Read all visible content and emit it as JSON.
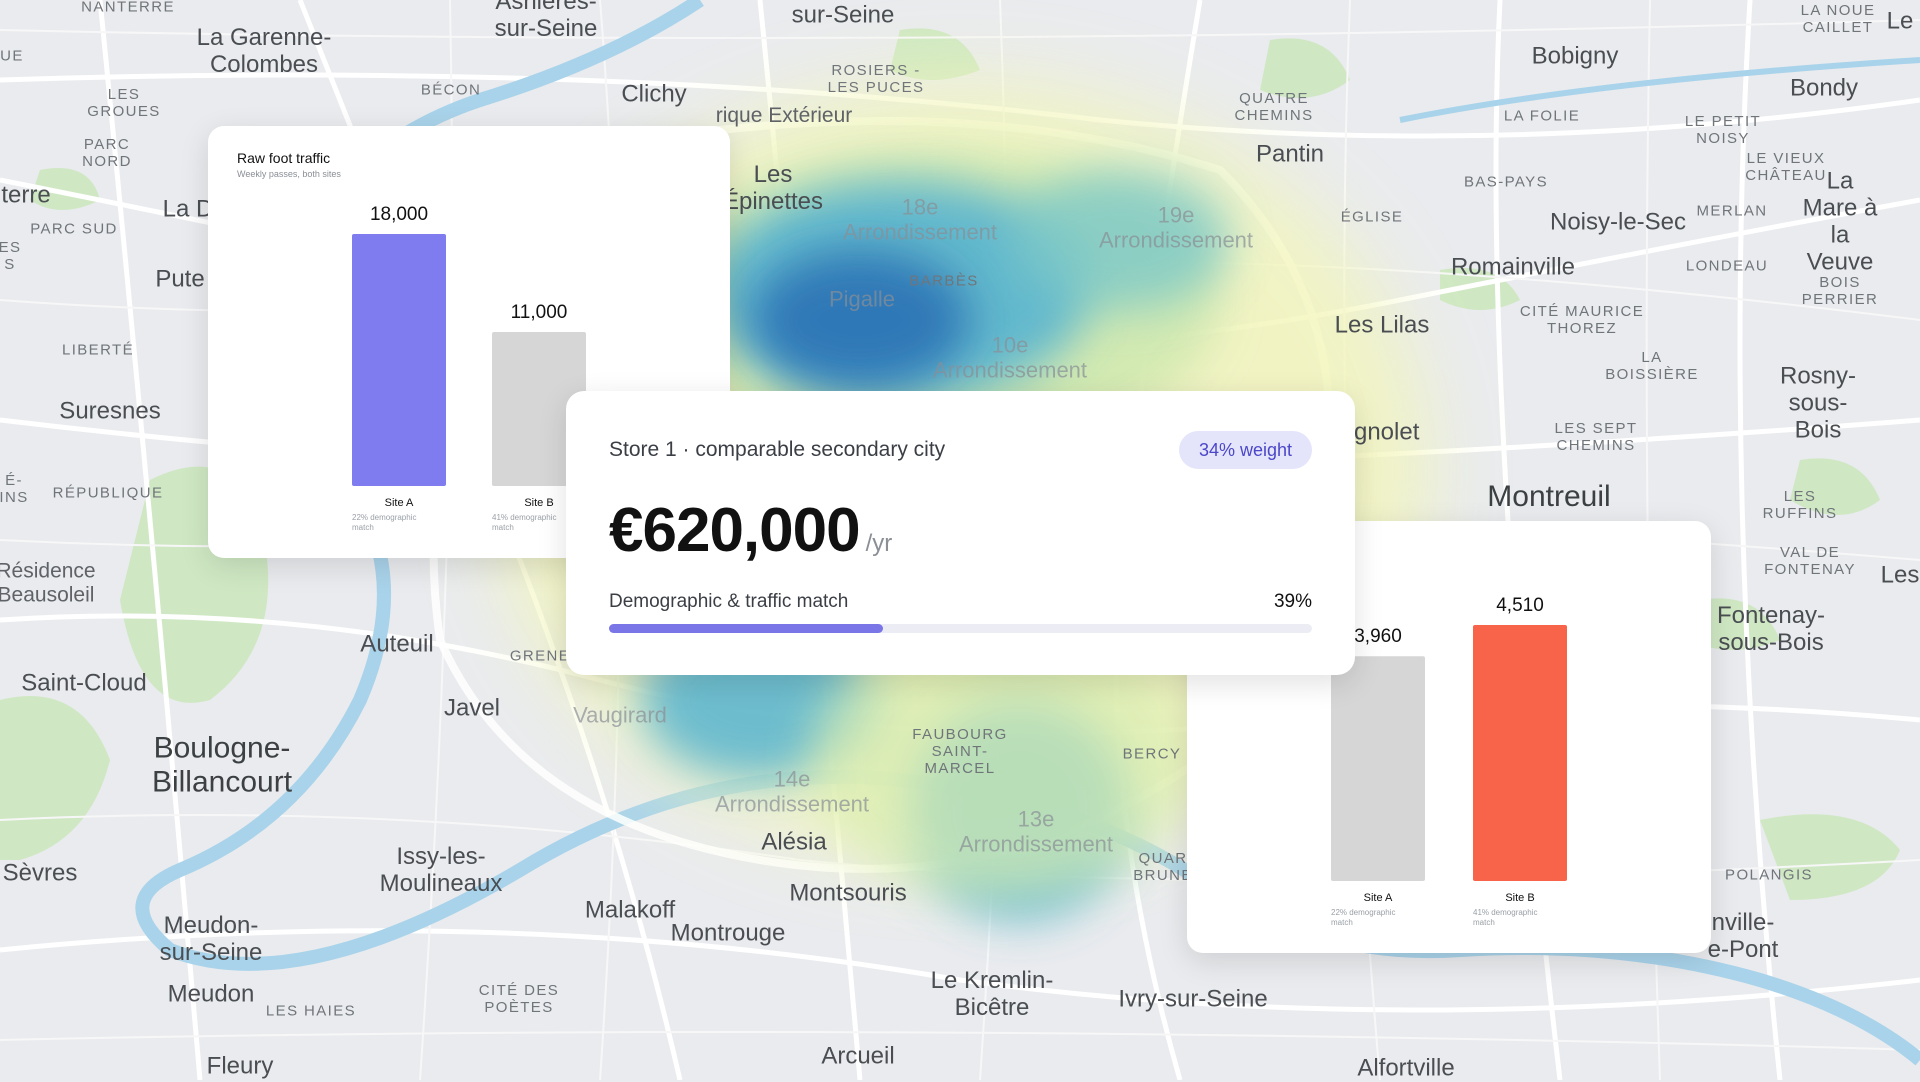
{
  "map": {
    "places": [
      {
        "name": "Nanterre",
        "text": "NANTERRE",
        "style": "dist"
      },
      {
        "name": "La Garenne-Colombes",
        "text": "La Garenne-\nColombes",
        "style": "mid"
      },
      {
        "name": "Asnieres-sur-Seine",
        "text": "Asnières-\nsur-Seine",
        "style": "mid"
      },
      {
        "name": "Clichy",
        "text": "Clichy",
        "style": "mid"
      },
      {
        "name": "Becon",
        "text": "BÉCON",
        "style": "dist"
      },
      {
        "name": "Les Groues",
        "text": "LES\nGROUES",
        "style": "dist"
      },
      {
        "name": "Parc Nord",
        "text": "PARC\nNORD",
        "style": "dist"
      },
      {
        "name": "Parc Sud",
        "text": "PARC SUD",
        "style": "dist"
      },
      {
        "name": "Liberte",
        "text": "LIBERTÉ",
        "style": "dist"
      },
      {
        "name": "Suresnes",
        "text": "Suresnes",
        "style": "mid"
      },
      {
        "name": "Republique",
        "text": "RÉPUBLIQUE",
        "style": "dist"
      },
      {
        "name": "Residence Beausoleil",
        "text": "Résidence\nBeausoleil",
        "style": ""
      },
      {
        "name": "Saint-Cloud",
        "text": "Saint-Cloud",
        "style": "mid"
      },
      {
        "name": "Boulogne-Billancourt",
        "text": "Boulogne-\nBillancourt",
        "style": "big"
      },
      {
        "name": "Auteuil",
        "text": "Auteuil",
        "style": "mid"
      },
      {
        "name": "Javel",
        "text": "Javel",
        "style": "mid"
      },
      {
        "name": "Sevres",
        "text": "Sèvres",
        "style": "mid"
      },
      {
        "name": "Issy-les-Moulineaux",
        "text": "Issy-les-\nMoulineaux",
        "style": "mid"
      },
      {
        "name": "Meudon-sur-Seine",
        "text": "Meudon-\nsur-Seine",
        "style": "mid"
      },
      {
        "name": "Meudon",
        "text": "Meudon",
        "style": "mid"
      },
      {
        "name": "Les Haies",
        "text": "LES HAIES",
        "style": "dist"
      },
      {
        "name": "Fleury",
        "text": "Fleury",
        "style": "mid"
      },
      {
        "name": "Malakoff",
        "text": "Malakoff",
        "style": "mid"
      },
      {
        "name": "Montrouge",
        "text": "Montrouge",
        "style": "mid"
      },
      {
        "name": "Cite des Poetes",
        "text": "CITÉ DES\nPOÈTES",
        "style": "dist"
      },
      {
        "name": "Montsouris",
        "text": "Montsouris",
        "style": "mid"
      },
      {
        "name": "Alesia",
        "text": "Alésia",
        "style": "mid"
      },
      {
        "name": "Le Kremlin-Bicetre",
        "text": "Le Kremlin-\nBicêtre",
        "style": "mid"
      },
      {
        "name": "Arcueil",
        "text": "Arcueil",
        "style": "mid"
      },
      {
        "name": "Ivry-sur-Seine",
        "text": "Ivry-sur-Seine",
        "style": "mid"
      },
      {
        "name": "Alfortville",
        "text": "Alfortville",
        "style": "mid"
      },
      {
        "name": "Rosiers les Puces",
        "text": "ROSIERS -\nLES PUCES",
        "style": "dist"
      },
      {
        "name": "Saint-Denis",
        "text": "sur-Seine",
        "style": "mid"
      },
      {
        "name": "Les Epinettes",
        "text": "Les\nÉpinettes",
        "style": "mid"
      },
      {
        "name": "Pantin",
        "text": "Pantin",
        "style": "mid"
      },
      {
        "name": "Quatre Chemins",
        "text": "QUATRE\nCHEMINS",
        "style": "dist"
      },
      {
        "name": "Bobigny",
        "text": "Bobigny",
        "style": "mid"
      },
      {
        "name": "La Folie",
        "text": "LA FOLIE",
        "style": "dist"
      },
      {
        "name": "Bondy",
        "text": "Bondy",
        "style": "mid"
      },
      {
        "name": "La Noue Caillet",
        "text": "LA NOUE\nCAILLET",
        "style": "dist"
      },
      {
        "name": "Le Petit Noisy",
        "text": "LE PETIT\nNOISY",
        "style": "dist"
      },
      {
        "name": "Le Vieux Chateau",
        "text": "LE VIEUX\nCHÂTEAU",
        "style": "dist"
      },
      {
        "name": "Bas-Pays",
        "text": "BAS-PAYS",
        "style": "dist"
      },
      {
        "name": "Eglise",
        "text": "ÉGLISE",
        "style": "dist"
      },
      {
        "name": "Noisy-le-Sec",
        "text": "Noisy-le-Sec",
        "style": "mid"
      },
      {
        "name": "Merlan",
        "text": "MERLAN",
        "style": "dist"
      },
      {
        "name": "La Mare a la Veuve",
        "text": "La Mare à\nla Veuve",
        "style": "mid"
      },
      {
        "name": "Romainville",
        "text": "Romainville",
        "style": "mid"
      },
      {
        "name": "Londeau",
        "text": "LONDEAU",
        "style": "dist"
      },
      {
        "name": "Bois Perrier",
        "text": "BOIS\nPERRIER",
        "style": "dist"
      },
      {
        "name": "Les Lilas",
        "text": "Les Lilas",
        "style": "mid"
      },
      {
        "name": "Cite Maurice Thorez",
        "text": "CITÉ MAURICE\nTHOREZ",
        "style": "dist"
      },
      {
        "name": "La Boissiere",
        "text": "LA\nBOISSIÈRE",
        "style": "dist"
      },
      {
        "name": "Rosny-sous-Bois",
        "text": "Rosny-\nsous-Bois",
        "style": "mid"
      },
      {
        "name": "Bagnolet",
        "text": "agnolet",
        "style": "mid"
      },
      {
        "name": "Les Sept Chemins",
        "text": "LES SEPT\nCHEMINS",
        "style": "dist"
      },
      {
        "name": "Montreuil",
        "text": "Montreuil",
        "style": "big"
      },
      {
        "name": "Les Ruffins",
        "text": "LES\nRUFFINS",
        "style": "dist"
      },
      {
        "name": "Val de Fontenay",
        "text": "VAL DE\nFONTENAY",
        "style": "dist"
      },
      {
        "name": "Fontenay-sous-Bois",
        "text": "Fontenay-\nsous-Bois",
        "style": "mid"
      },
      {
        "name": "Polangis",
        "text": "POLANGIS",
        "style": "dist"
      },
      {
        "name": "Joinville-le-Pont",
        "text": "nville-\ne-Pont",
        "style": "mid"
      },
      {
        "name": "Bercy",
        "text": "BERCY",
        "style": "dist"
      },
      {
        "name": "Quartier Bruneseau",
        "text": "QUAR\nBRUNE",
        "style": "dist"
      },
      {
        "name": "Grenelle",
        "text": "GRENE",
        "style": "dist"
      },
      {
        "name": "Vaugirard",
        "text": "Vaugirard",
        "style": "arr"
      },
      {
        "name": "Pigalle",
        "text": "Pigalle",
        "style": "arr"
      },
      {
        "name": "Barbes",
        "text": "BARBÈS",
        "style": "dist"
      },
      {
        "name": "18e Arrondissement",
        "text": "18e\nArrondissement",
        "style": "arr"
      },
      {
        "name": "19e Arrondissement",
        "text": "19e\nArrondissement",
        "style": "arr"
      },
      {
        "name": "10e Arrondissement",
        "text": "10e\nArrondissement",
        "style": "arr"
      },
      {
        "name": "14e Arrondissement",
        "text": "14e\nArrondissement",
        "style": "arr"
      },
      {
        "name": "13e Arrondissement",
        "text": "13e\nArrondissement",
        "style": "arr"
      },
      {
        "name": "Faubourg Saint-Marcel",
        "text": "FAUBOURG\nSAINT-\nMARCEL",
        "style": "dist"
      },
      {
        "name": "Boulevard Peripherique",
        "text": "rique Extérieur",
        "style": ""
      },
      {
        "name": "Puteaux",
        "text": "Pute",
        "style": "mid"
      },
      {
        "name": "La Defense",
        "text": "La D",
        "style": "mid"
      },
      {
        "name": "Nanterre West",
        "text": "terre",
        "style": "mid"
      },
      {
        "name": "Rue",
        "text": "UE",
        "style": "dist"
      },
      {
        "name": "Les",
        "text": "ES\nS",
        "style": "dist"
      },
      {
        "name": "Ins",
        "text": "É-\nINS",
        "style": "dist"
      },
      {
        "name": "Le",
        "text": "Le",
        "style": "mid"
      },
      {
        "name": "Les East",
        "text": "Les",
        "style": "mid"
      }
    ]
  },
  "traffic_card": {
    "title": "Raw foot traffic",
    "subtitle": "Weekly passes, both sites"
  },
  "store_card": {
    "heading": "Store 1 · comparable secondary city",
    "badge": "34% weight",
    "amount": "€620,000",
    "per": "/yr",
    "match_label": "Demographic & traffic match",
    "match_value": "39%",
    "match_fraction": 0.39
  },
  "colors": {
    "accent": "#7f7cf0",
    "neutral_bar": "#d6d6d6",
    "highlight_bar": "#f7644a",
    "progress_fill": "#7a76e8"
  },
  "chart_data": [
    {
      "type": "bar",
      "title": "Raw foot traffic",
      "subtitle": "Weekly passes, both sites",
      "categories": [
        "Site A",
        "Site B"
      ],
      "category_notes": [
        "22% demographic\nmatch",
        "41% demographic\nmatch"
      ],
      "values": [
        18000,
        11000
      ],
      "value_labels": [
        "18,000",
        "11,000"
      ],
      "colors": [
        "#7f7cf0",
        "#d6d6d6"
      ],
      "ylim": [
        0,
        18000
      ]
    },
    {
      "type": "bar",
      "categories": [
        "Site A",
        "Site B"
      ],
      "category_notes": [
        "22% demographic\nmatch",
        "41% demographic\nmatch"
      ],
      "values": [
        3960,
        4510
      ],
      "value_labels": [
        "3,960",
        "4,510"
      ],
      "colors": [
        "#d6d6d6",
        "#f7644a"
      ],
      "ylim": [
        0,
        4510
      ]
    }
  ]
}
